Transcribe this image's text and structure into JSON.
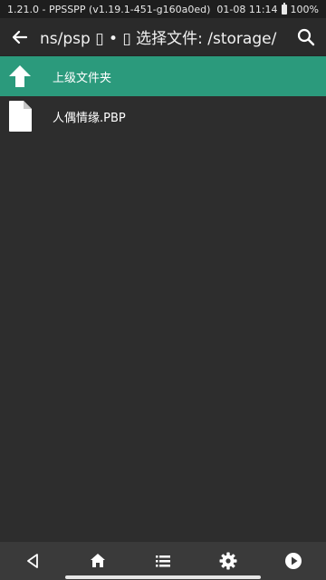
{
  "status_bar": {
    "app_version": "1.21.0 - PPSSPP (v1.19.1-451-g160a0ed)",
    "datetime": "01-08 11:14",
    "battery": "100%"
  },
  "header": {
    "title": "ns/psp ▯ • ▯ 选择文件: /storage/",
    "back_icon": "arrow-left-icon",
    "search_icon": "search-icon"
  },
  "file_list": {
    "items": [
      {
        "label": "上级文件夹",
        "icon": "arrow-up-icon",
        "selected": true
      },
      {
        "label": "人偶情缘.PBP",
        "icon": "file-icon",
        "selected": false
      }
    ]
  },
  "nav_bar": {
    "buttons": [
      "back-triangle-icon",
      "home-icon",
      "list-icon",
      "gear-icon",
      "play-icon"
    ]
  },
  "colors": {
    "background": "#2d2d2d",
    "selected_row": "#2b9a7c",
    "nav_bar": "#3a3a3a"
  }
}
